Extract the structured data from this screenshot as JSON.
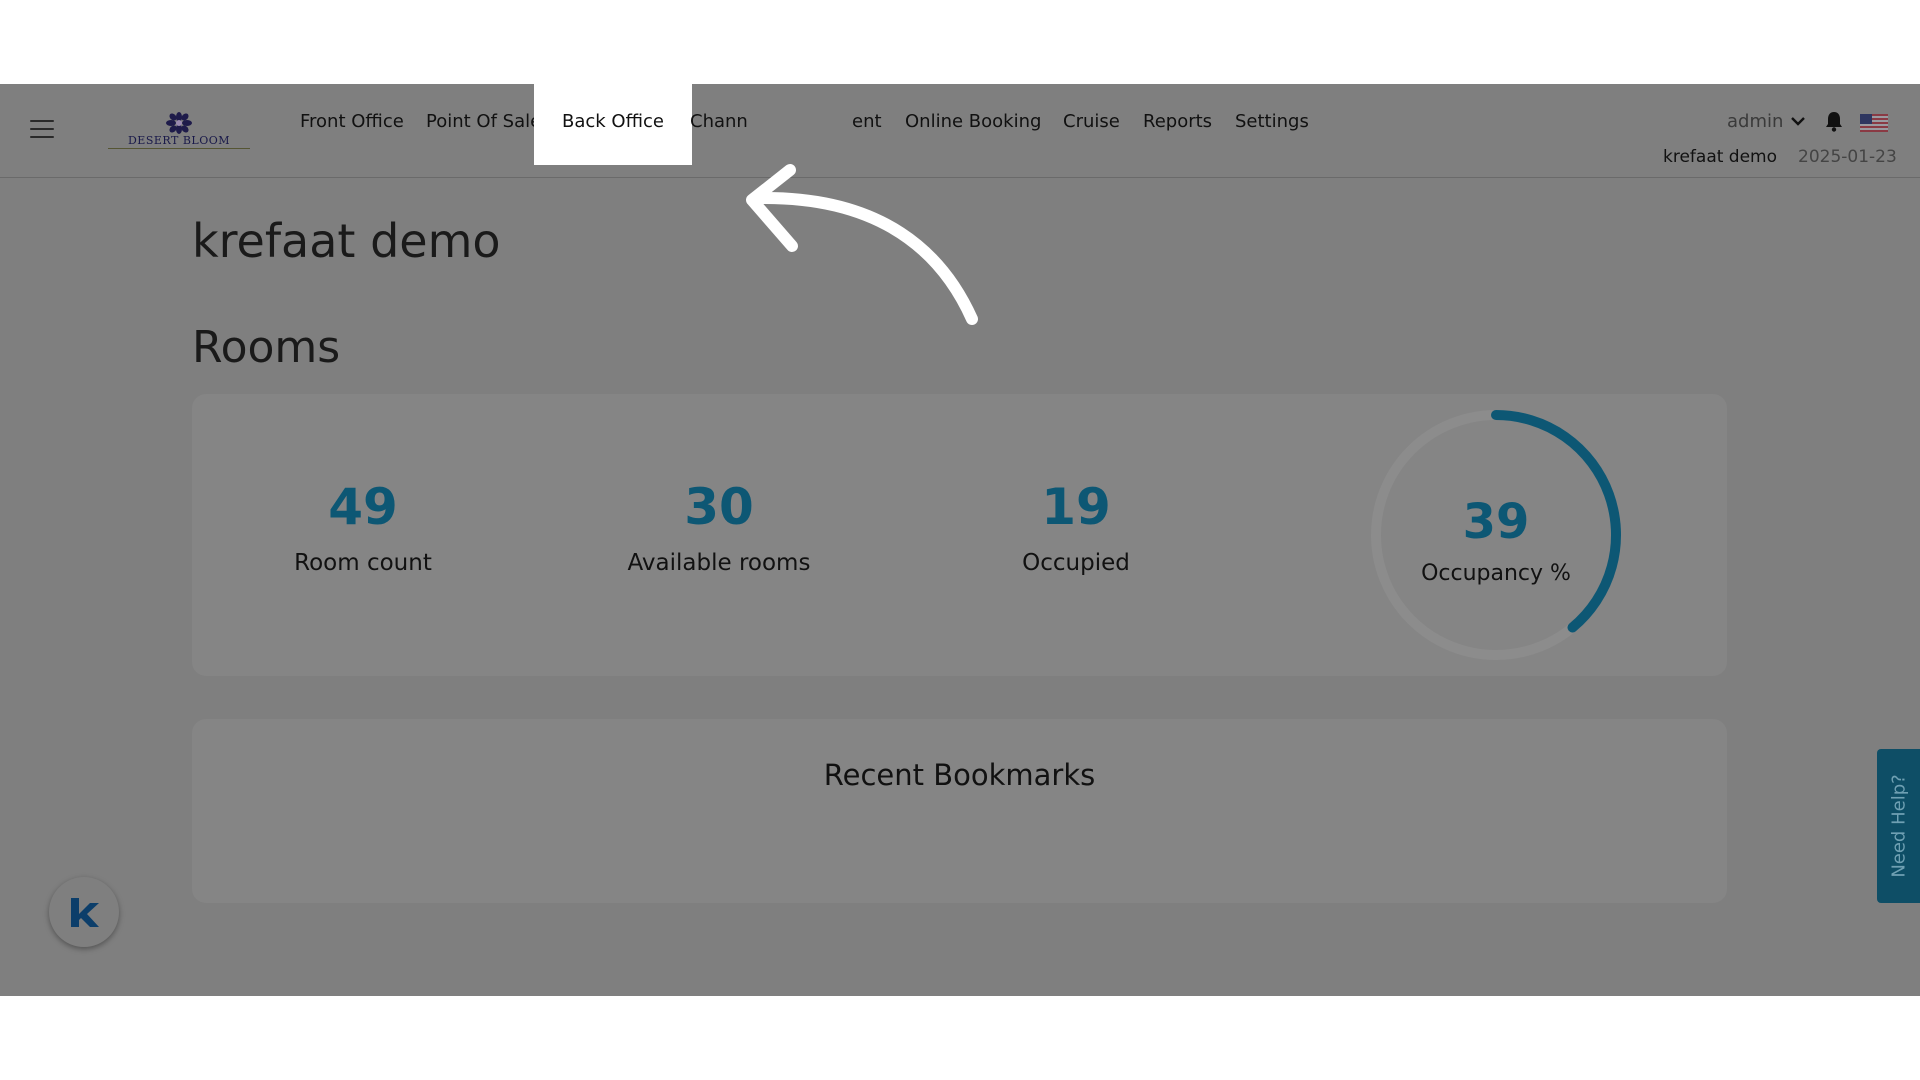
{
  "brand": {
    "logo_text": "DESERT BLOOM"
  },
  "nav": {
    "items": [
      "Front Office",
      "Point Of Sale",
      "Back Office",
      "Chann",
      "ent",
      "Online Booking",
      "Cruise",
      "Reports",
      "Settings"
    ]
  },
  "user": {
    "name": "admin"
  },
  "hotel": {
    "name": "krefaat demo",
    "business_date": "2025-01-23"
  },
  "page": {
    "title": "krefaat demo",
    "section": "Rooms"
  },
  "stats": [
    {
      "value": "49",
      "label": "Room count"
    },
    {
      "value": "30",
      "label": "Available rooms"
    },
    {
      "value": "19",
      "label": "Occupied"
    }
  ],
  "occupancy": {
    "value": "39",
    "label": "Occupancy %",
    "percent": 39
  },
  "bookmarks": {
    "title": "Recent Bookmarks"
  },
  "help": {
    "label": "Need Help?"
  },
  "colors": {
    "accent": "#0d5774",
    "overlay": "#7f7f7f",
    "help_tab": "#0e4e66"
  },
  "icons": [
    "menu-icon",
    "bell-icon",
    "us-flag-icon",
    "chevron-down-icon",
    "k-logo-icon",
    "arrow-pointer-icon"
  ]
}
